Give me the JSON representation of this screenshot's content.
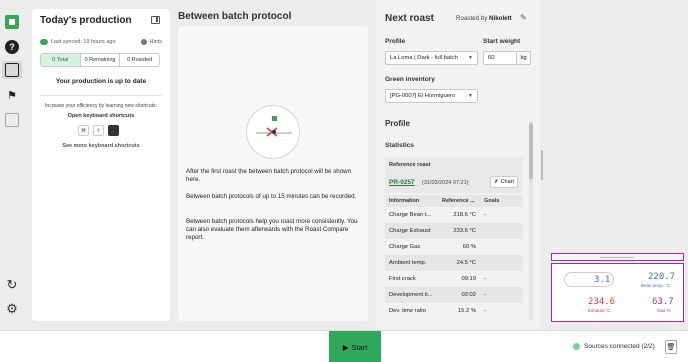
{
  "production": {
    "title": "Today's production",
    "last_synced": "Last synced: 19 hours ago",
    "hints": "Hints",
    "tabs": [
      "0 Total",
      "0 Remaining",
      "0 Roasted"
    ],
    "up_to_date": "Your production is up to date",
    "efficiency": "Increase your efficiency by learning new shortcuts:",
    "open_shortcuts": "Open keyboard shortcuts",
    "keys": [
      "⌘",
      "⇧",
      "."
    ],
    "more_shortcuts": "See more keyboard shortcuts"
  },
  "bbp": {
    "title": "Between batch protocol",
    "p1": "After the first roast the between batch protocol will be shown here.",
    "p2": "Between batch protocols of up to 15 minutes can be recorded.",
    "p3": "Between batch protocols help you roast more consistently. You can also evaluate them afterwards with the Roast Compare report."
  },
  "next_roast": {
    "title": "Next roast",
    "roasted_by_prefix": "Roasted by",
    "roaster": "Nikolett",
    "profile_label": "Profile",
    "profile_value": "La Loma | Dark - full batch",
    "start_weight_label": "Start weight",
    "start_weight_value": "60",
    "start_weight_unit": "kg",
    "green_label": "Green inventory",
    "green_value": "[PG-0007] El Hormiguero",
    "profile_section": "Profile",
    "statistics": "Statistics",
    "reference_label": "Reference roast",
    "reference_id": "PR-0257",
    "reference_date": "(31/03/2024 07:21)",
    "chart_button": "Chart",
    "table_headers": [
      "Information",
      "Reference ...",
      "Goals"
    ],
    "rows": [
      {
        "info": "Charge Bean t...",
        "ref": "218.6 °C",
        "goal": "-"
      },
      {
        "info": "Charge Exhaust",
        "ref": "233.6 °C",
        "goal": ""
      },
      {
        "info": "Charge Gas",
        "ref": "60 %",
        "goal": ""
      },
      {
        "info": "Ambient temp.",
        "ref": "24.5 °C",
        "goal": ""
      },
      {
        "info": "First crack",
        "ref": "09:19",
        "goal": "-"
      },
      {
        "info": "Development ti...",
        "ref": "02:02",
        "goal": "-"
      },
      {
        "info": "Dev. time ratio",
        "ref": "15.2 %",
        "goal": "-"
      }
    ]
  },
  "sensor": {
    "ror": "3.1",
    "bean_temp": "220.7",
    "bean_label": "Bean temp. °C",
    "exhaust": "234.6",
    "exhaust_label": "Exhaust °C",
    "gas": "63.7",
    "gas_label": "Gas %",
    "colors": {
      "bean": "#3b6fc9",
      "exhaust": "#d23b3b",
      "gas": "#9b2fa0",
      "frame": "#9b2fa0"
    }
  },
  "bottom": {
    "start": "Start",
    "sources": "Sources connected (2/2)"
  },
  "colors": {
    "accent": "#2fa85c",
    "link": "#2a7b3e"
  }
}
